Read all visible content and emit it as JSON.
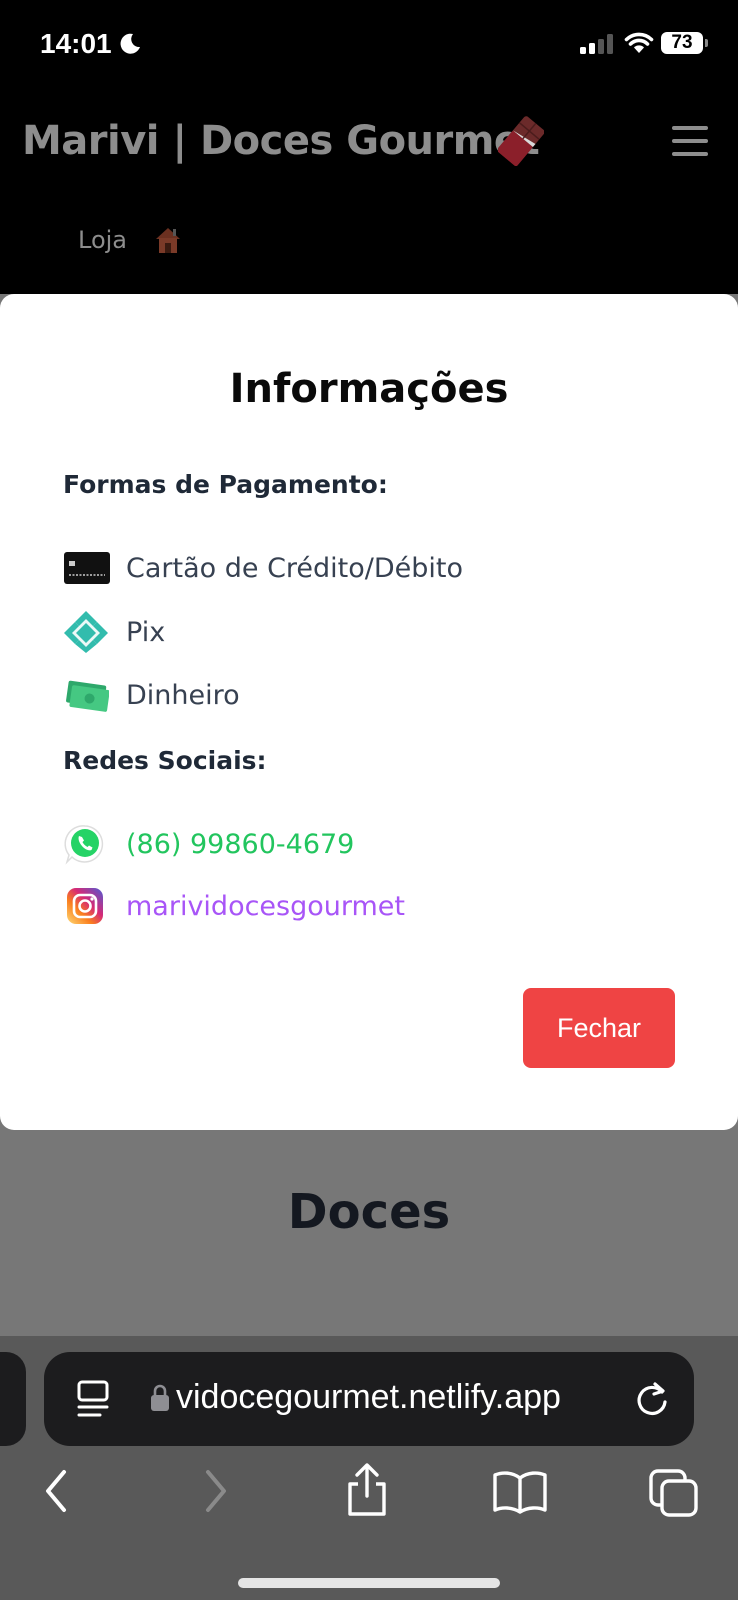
{
  "status_bar": {
    "time": "14:01",
    "battery": "73",
    "icons": [
      "moon-icon",
      "signal-icon",
      "wifi-icon",
      "battery-icon"
    ]
  },
  "header": {
    "title": "Marivi | Doces Gourmet",
    "title_emoji_icon": "chocolate-bar-icon",
    "menu_icon": "hamburger-menu-icon",
    "nav": [
      {
        "label": "Loja",
        "icon": "house-icon"
      }
    ]
  },
  "modal": {
    "title": "Informações",
    "payment": {
      "heading": "Formas de Pagamento:",
      "items": [
        {
          "label": "Cartão de Crédito/Débito",
          "icon": "credit-card-icon"
        },
        {
          "label": "Pix",
          "icon": "pix-icon"
        },
        {
          "label": "Dinheiro",
          "icon": "cash-icon"
        }
      ]
    },
    "social": {
      "heading": "Redes Sociais:",
      "items": [
        {
          "label": "(86) 99860-4679",
          "icon": "whatsapp-icon",
          "color": "#22c55e"
        },
        {
          "label": "marividocesgourmet",
          "icon": "instagram-icon",
          "color": "#a855f7"
        }
      ]
    },
    "close_label": "Fechar",
    "close_color": "#ef4444"
  },
  "page": {
    "section_title": "Doces"
  },
  "browser": {
    "url": "vidocegourmet.netlify.app",
    "icons": [
      "reader-mode-icon",
      "lock-icon",
      "reload-icon",
      "back-icon",
      "forward-icon",
      "share-icon",
      "bookmarks-icon",
      "tabs-icon"
    ]
  }
}
